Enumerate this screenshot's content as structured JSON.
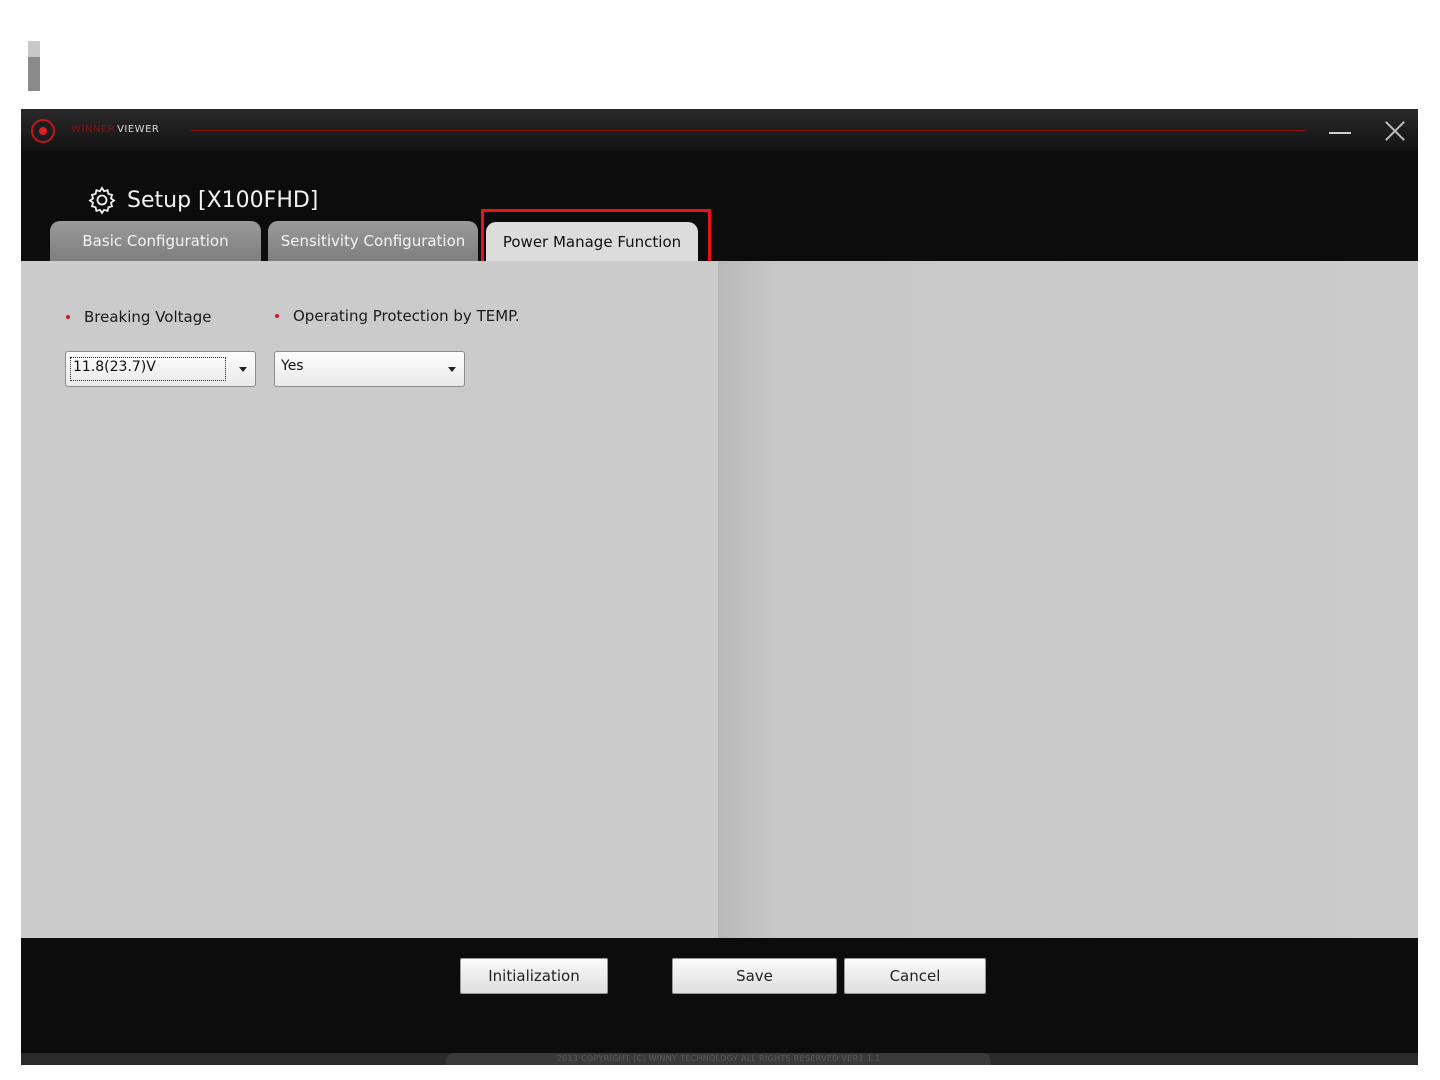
{
  "app": {
    "brand_red": "WINNER",
    "brand_white": "VIEWER",
    "accent_color": "#c01818"
  },
  "window_controls": {
    "minimize_icon": "minimize-icon",
    "close_icon": "close-icon"
  },
  "header": {
    "title": "Setup [X100FHD]",
    "icon": "gear-icon"
  },
  "tabs": [
    {
      "label": "Basic Configuration",
      "active": false
    },
    {
      "label": "Sensitivity Configuration",
      "active": false
    },
    {
      "label": "Power Manage Function",
      "active": true
    }
  ],
  "fields": {
    "breaking_voltage": {
      "label": "Breaking Voltage",
      "value": "11.8(23.7)V"
    },
    "temp_protection": {
      "label": "Operating Protection by TEMP.",
      "value": "Yes"
    }
  },
  "footer": {
    "init_label": "Initialization",
    "save_label": "Save",
    "cancel_label": "Cancel"
  },
  "status": {
    "copyright": "2013 COPYRIGHT (C) WINNY TECHNOLOGY ALL RIGHTS RESERVED VER1.1.1"
  },
  "highlight_color": "#e8141c"
}
